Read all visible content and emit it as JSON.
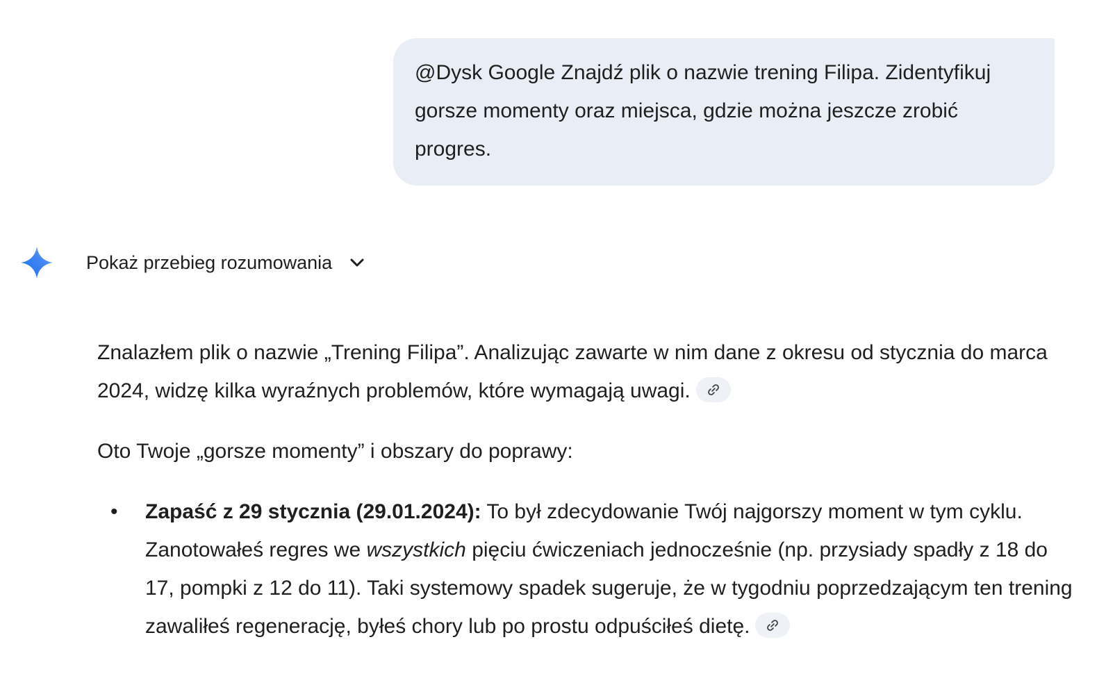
{
  "user_message": {
    "text": "@Dysk Google Znajdź plik o nazwie trening Filipa. Zidentyfikuj gorsze momenty oraz miejsca, gdzie można jeszcze zrobić progres."
  },
  "reasoning": {
    "icon": "gemini-sparkle-icon",
    "label": "Pokaż przebieg rozumowania",
    "toggle_icon": "chevron-down-icon"
  },
  "response": {
    "paragraph1": "Znalazłem plik o nazwie „Trening Filipa”. Analizując zawarte w nim dane z okresu od stycznia do marca 2024, widzę kilka wyraźnych problemów, które wymagają uwagi.",
    "paragraph2": "Oto Twoje „gorsze momenty” i obszary do poprawy:",
    "bullets": [
      {
        "marker": "•",
        "bold": "Zapaść z 29 stycznia (29.01.2024):",
        "text_before_italic": " To był zdecydowanie Twój najgorszy moment w tym cyklu. Zanotowałeś regres we ",
        "italic": "wszystkich",
        "text_after_italic": " pięciu ćwiczeniach jednocześnie (np. przysiady spadły z 18 do 17, pompki z 12 do 11). Taki systemowy spadek sugeruje, że w tygodniu poprzedzającym ten trening zawaliłeś regenerację, byłeś chory lub po prostu odpuściłeś dietę."
      }
    ],
    "source_chip_icon": "link-icon"
  },
  "colors": {
    "user_bubble_bg": "#e9eef6",
    "chip_bg": "#eef1f6",
    "gemini_blue": "#4285f4",
    "text": "#1f1f1f"
  }
}
